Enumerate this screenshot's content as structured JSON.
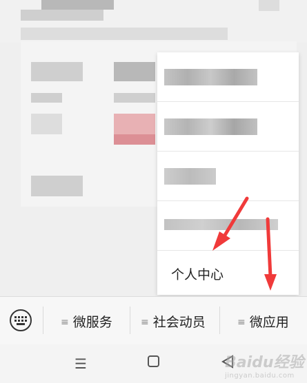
{
  "menu": {
    "items": [
      {
        "label": ""
      },
      {
        "label": ""
      },
      {
        "label": ""
      },
      {
        "label": ""
      },
      {
        "label": "个人中心"
      }
    ]
  },
  "bottom_bar": {
    "tabs": [
      {
        "label": "微服务"
      },
      {
        "label": "社会动员"
      },
      {
        "label": "微应用"
      }
    ]
  },
  "watermark": {
    "text": "Baidu经验",
    "sub": "jingyan.baidu.com"
  },
  "colors": {
    "arrow": "#f03a3a",
    "menu_bg": "#ffffff"
  }
}
